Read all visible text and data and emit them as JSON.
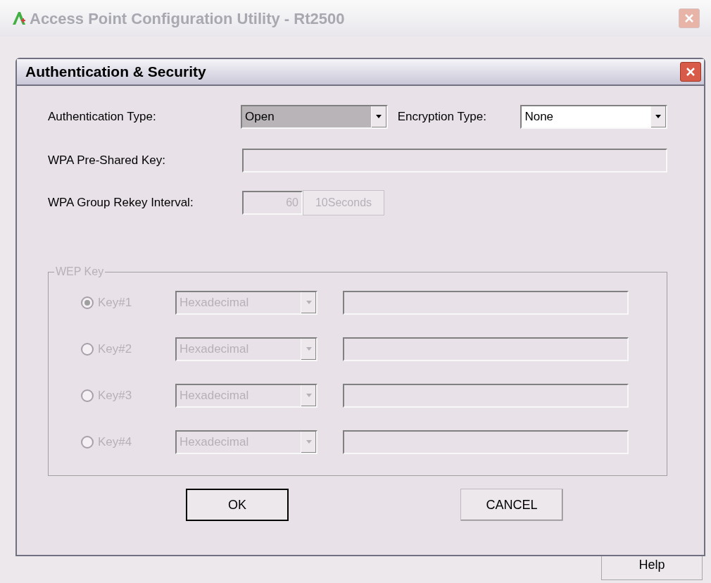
{
  "main_window": {
    "title": "Access Point Configuration Utility - Rt2500",
    "help_button": "Help"
  },
  "dialog": {
    "title": "Authentication & Security",
    "authentication_type": {
      "label": "Authentication Type:",
      "value": "Open",
      "focused": true
    },
    "encryption_type": {
      "label": "Encryption Type:",
      "value": "None",
      "focused": false
    },
    "wpa_psk": {
      "label": "WPA Pre-Shared Key:",
      "disabled": true
    },
    "rekey": {
      "label": "WPA Group Rekey Interval:",
      "value": "60",
      "unit": "10Seconds",
      "disabled": true
    },
    "wep": {
      "title": "WEP Key",
      "disabled": true,
      "keys": [
        {
          "label": "Key#1",
          "format": "Hexadecimal",
          "selected": true
        },
        {
          "label": "Key#2",
          "format": "Hexadecimal",
          "selected": false
        },
        {
          "label": "Key#3",
          "format": "Hexadecimal",
          "selected": false
        },
        {
          "label": "Key#4",
          "format": "Hexadecimal",
          "selected": false
        }
      ]
    },
    "buttons": [
      {
        "label": "OK",
        "default": true
      },
      {
        "label": "CANCEL",
        "default": false
      }
    ]
  }
}
